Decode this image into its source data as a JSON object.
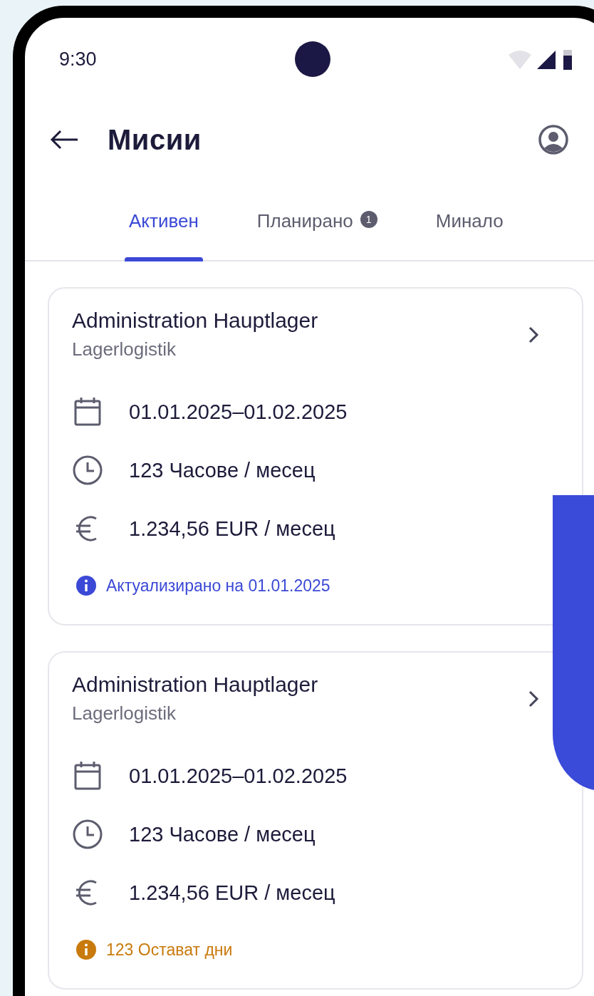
{
  "status_bar": {
    "time": "9:30"
  },
  "header": {
    "title": "Мисии"
  },
  "tabs": [
    {
      "label": "Активен",
      "selected": true
    },
    {
      "label": "Планирано",
      "badge": "1",
      "selected": false
    },
    {
      "label": "Минало",
      "selected": false
    }
  ],
  "missions": [
    {
      "title": "Administration Hauptlager",
      "subtitle": "Lagerlogistik",
      "details": [
        {
          "kind": "date",
          "text": "01.01.2025–01.02.2025"
        },
        {
          "kind": "hours",
          "text": "123 Часове / месец"
        },
        {
          "kind": "cost",
          "text": "1.234,56 EUR / месец"
        }
      ],
      "notice": {
        "kind": "info",
        "text": "Актуализирано на 01.01.2025"
      }
    },
    {
      "title": "Administration Hauptlager",
      "subtitle": "Lagerlogistik",
      "details": [
        {
          "kind": "date",
          "text": "01.01.2025–01.02.2025"
        },
        {
          "kind": "hours",
          "text": "123 Часове / месец"
        },
        {
          "kind": "cost",
          "text": "1.234,56 EUR / месец"
        }
      ],
      "notice": {
        "kind": "warning",
        "text": "123 Остават дни"
      }
    }
  ]
}
